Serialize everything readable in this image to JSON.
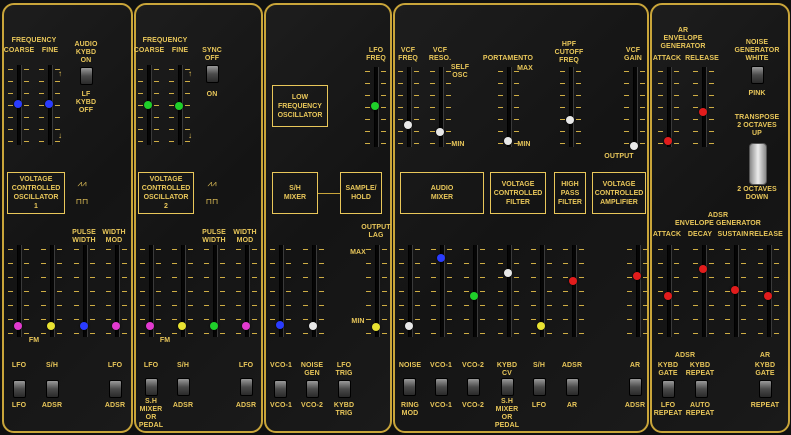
{
  "colors": {
    "accent": "#e9c75a",
    "border": "#c9a53a",
    "blue": "#2a3cff",
    "green": "#1fcf2a",
    "magenta": "#e23ad0",
    "yellow": "#e8e232",
    "white": "#e8e8e8",
    "red": "#e21c1c"
  },
  "vco1": {
    "frequency": "FREQUENCY",
    "coarse": "COARSE",
    "fine": "FINE",
    "audio_kybd_on": "AUDIO\nKYBD\nON",
    "lf_kybd_off": "LF\nKYBD\nOFF",
    "box": "VOLTAGE\nCONTROLLED\nOSCILLATOR\n1",
    "pulse_width": "PULSE\nWIDTH",
    "width_mod": "WIDTH\nMOD",
    "fm": "FM",
    "src_lfo": "LFO",
    "src_sh": "S/H",
    "src_lfo_b": "LFO",
    "src_adsr": "ADSR",
    "src_lfo2": "LFO",
    "src_adsr2": "ADSR"
  },
  "vco2": {
    "frequency": "FREQUENCY",
    "coarse": "COARSE",
    "fine": "FINE",
    "sync_off": "SYNC\nOFF",
    "sync_on": "ON",
    "box": "VOLTAGE\nCONTROLLED\nOSCILLATOR\n2",
    "pulse_width": "PULSE\nWIDTH",
    "width_mod": "WIDTH\nMOD",
    "fm": "FM",
    "src_lfo": "LFO",
    "src_sh": "S/H",
    "src_shmix": "S.H\nMIXER\nOR\nPEDAL",
    "src_adsr": "ADSR",
    "src_lfo2": "LFO",
    "src_adsr2": "ADSR"
  },
  "lfo": {
    "lfo_freq": "LFO\nFREQ",
    "box": "LOW\nFREQUENCY\nOSCILLATOR",
    "sh_mixer": "S/H\nMIXER",
    "sample_hold": "SAMPLE/\nHOLD",
    "output_lag": "OUTPUT\nLAG",
    "max": "MAX",
    "min": "MIN",
    "vco1": "VCO-1",
    "noise_gen": "NOISE\nGEN",
    "lfo_trig": "LFO\nTRIG",
    "vco1b": "VCO-1",
    "vco2": "VCO-2",
    "kybd_trig": "KYBD\nTRIG"
  },
  "main": {
    "vcf_freq": "VCF\nFREQ",
    "vcf_reso": "VCF\nRESO.",
    "self_osc": "SELF\nOSC",
    "portamento": "PORTAMENTO",
    "max": "MAX",
    "min": "MIN",
    "min2": "MIN",
    "hpf_cutoff": "HPF\nCUTOFF\nFREQ",
    "vcf_gain": "VCF\nGAIN",
    "output": "OUTPUT",
    "audio_mixer": "AUDIO\nMIXER",
    "vcf_box": "VOLTAGE\nCONTROLLED\nFILTER",
    "hpf_box": "HIGH\nPASS\nFILTER",
    "vca_box": "VOLTAGE\nCONTROLLED\nAMPLIFIER",
    "noise": "NOISE",
    "vco1": "VCO-1",
    "vco2": "VCO-2",
    "kybd_cv": "KYBD\nCV",
    "sh": "S/H",
    "adsr": "ADSR",
    "ar": "AR",
    "ring_mod": "RING\nMOD",
    "vco1b": "VCO-1",
    "vco2b": "VCO-2",
    "shmix": "S.H\nMIXER\nOR\nPEDAL",
    "lfo": "LFO",
    "ar2": "AR",
    "adsr2": "ADSR"
  },
  "env": {
    "ar_gen": "AR\nENVELOPE\nGENERATOR",
    "attack": "ATTACK",
    "release": "RELEASE",
    "noise_gen": "NOISE\nGENERATOR\nWHITE",
    "pink": "PINK",
    "transpose": "TRANSPOSE\n2 OCTAVES\nUP",
    "down": "2 OCTAVES\nDOWN",
    "adsr_gen": "ADSR\nENVELOPE GENERATOR",
    "a": "ATTACK",
    "d": "DECAY",
    "s": "SUSTAIN",
    "r": "RELEASE",
    "adsr_lbl": "ADSR",
    "kybd_gate": "KYBD\nGATE",
    "kybd_repeat": "KYBD\nREPEAT",
    "lfo_repeat": "LFO\nREPEAT",
    "auto_repeat": "AUTO\nREPEAT",
    "ar_lbl": "AR",
    "kybd_gate2": "KYBD\nGATE",
    "repeat": "REPEAT"
  }
}
